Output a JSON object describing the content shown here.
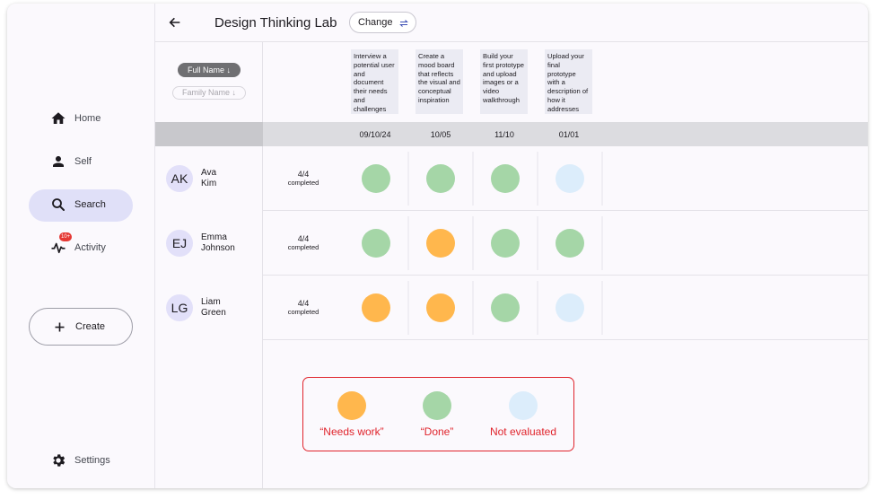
{
  "colors": {
    "needs_work": "#ffb74d",
    "done": "#a5d6a7",
    "not_evaluated": "#dcedfb",
    "legend_red": "#e0242c"
  },
  "sidebar": {
    "items": [
      {
        "label": "Home",
        "icon": "home-icon"
      },
      {
        "label": "Self",
        "icon": "person-icon"
      },
      {
        "label": "Search",
        "icon": "search-icon",
        "active": true
      },
      {
        "label": "Activity",
        "icon": "activity-icon",
        "badge": "10+"
      }
    ],
    "create_label": "Create",
    "settings_label": "Settings"
  },
  "header": {
    "title": "Design Thinking Lab",
    "change_label": "Change"
  },
  "sort": {
    "active": "Full Name ↓",
    "inactive": "Family Name ↓"
  },
  "tasks": [
    {
      "text": "Interview a potential user and document their needs and challenges",
      "date": "09/10/24"
    },
    {
      "text": "Create a mood board that reflects the visual and conceptual inspiration",
      "date": "10/05"
    },
    {
      "text": "Build your first prototype and upload images or a video walkthrough",
      "date": "11/10"
    },
    {
      "text": "Upload your final prototype with a description of how it addresses",
      "date": "01/01"
    }
  ],
  "students": [
    {
      "initials": "AK",
      "first": "Ava",
      "last": "Kim",
      "count": "4/4",
      "status_text": "completed",
      "statuses": [
        "done",
        "done",
        "done",
        "not_evaluated"
      ]
    },
    {
      "initials": "EJ",
      "first": "Emma",
      "last": "Johnson",
      "count": "4/4",
      "status_text": "completed",
      "statuses": [
        "done",
        "needs_work",
        "done",
        "done"
      ]
    },
    {
      "initials": "LG",
      "first": "Liam",
      "last": "Green",
      "count": "4/4",
      "status_text": "completed",
      "statuses": [
        "needs_work",
        "needs_work",
        "done",
        "not_evaluated"
      ]
    }
  ],
  "legend": {
    "needs_work": "“Needs work”",
    "done": "“Done”",
    "not_evaluated": "Not evaluated"
  }
}
